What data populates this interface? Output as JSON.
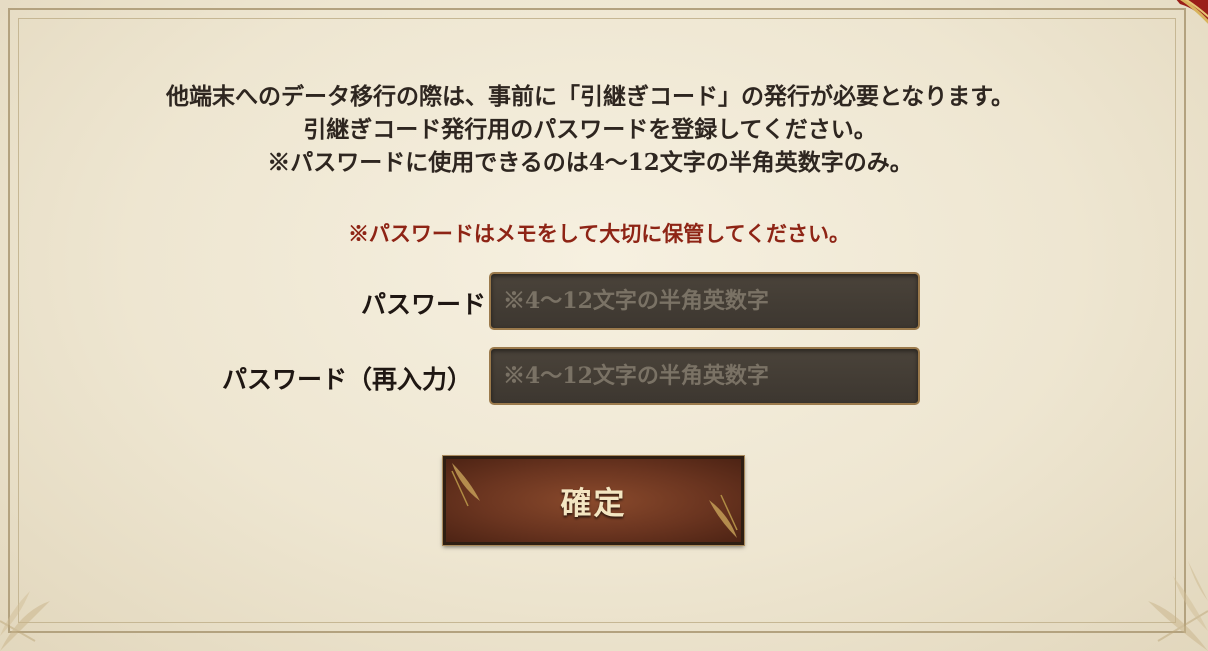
{
  "dialog": {
    "intro_lines": [
      "他端末へのデータ移行の際は、事前に「引継ぎコード」の発行が必要となります。",
      "引継ぎコード発行用のパスワードを登録してください。",
      "※パスワードに使用できるのは4〜12文字の半角英数字のみ。"
    ],
    "warning": "※パスワードはメモをして大切に保管してください。",
    "password_label": "パスワード",
    "password_placeholder": "※4〜12文字の半角英数字",
    "password_value": "",
    "confirm_label": "パスワード（再入力）",
    "confirm_placeholder": "※4〜12文字の半角英数字",
    "confirm_value": "",
    "submit_label": "確定"
  },
  "colors": {
    "background": "#eee6d1",
    "text": "#2e2620",
    "warning": "#8e2415",
    "input_bg": "#4a433a",
    "button": "#6b3520",
    "frame": "#b3a27f"
  },
  "icons": [
    "corner-ornament-icon",
    "leaf-decor-icon"
  ]
}
